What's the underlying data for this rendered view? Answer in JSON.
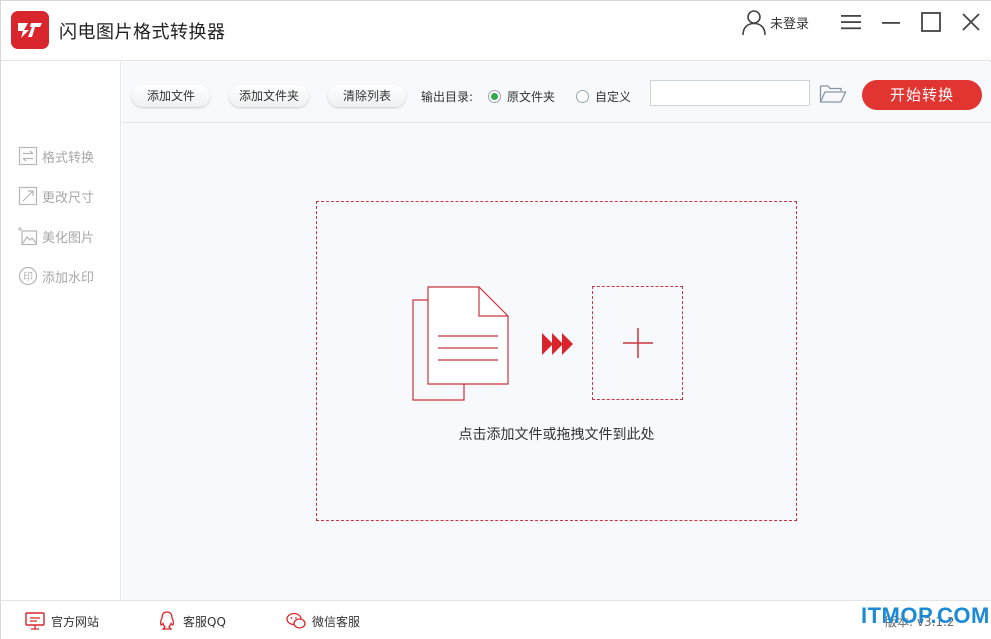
{
  "app": {
    "title": "闪电图片格式转换器",
    "brand_color": "#d8262c"
  },
  "titlebar": {
    "user_label": "未登录",
    "icons": [
      "user-icon",
      "menu-icon",
      "minimize-icon",
      "maximize-icon",
      "close-icon"
    ]
  },
  "sidebar": {
    "items": [
      {
        "label": "格式转换",
        "icon": "convert-icon"
      },
      {
        "label": "更改尺寸",
        "icon": "resize-icon"
      },
      {
        "label": "美化图片",
        "icon": "beautify-icon"
      },
      {
        "label": "添加水印",
        "icon": "watermark-icon"
      }
    ]
  },
  "toolbar": {
    "add_file": "添加文件",
    "add_folder": "添加文件夹",
    "clear_list": "清除列表",
    "output_label": "输出目录:",
    "radio_original": "原文件夹",
    "radio_custom": "自定义",
    "selected_output": "原文件夹",
    "path_value": "",
    "start_button": "开始转换",
    "accent_color": "#e23430"
  },
  "main": {
    "drop_text": "点击添加文件或拖拽文件到此处"
  },
  "statusbar": {
    "website": "官方网站",
    "qq": "客服QQ",
    "wechat": "微信客服",
    "version": "版本: v3.1.2"
  },
  "watermark": "ITMOP.COM"
}
